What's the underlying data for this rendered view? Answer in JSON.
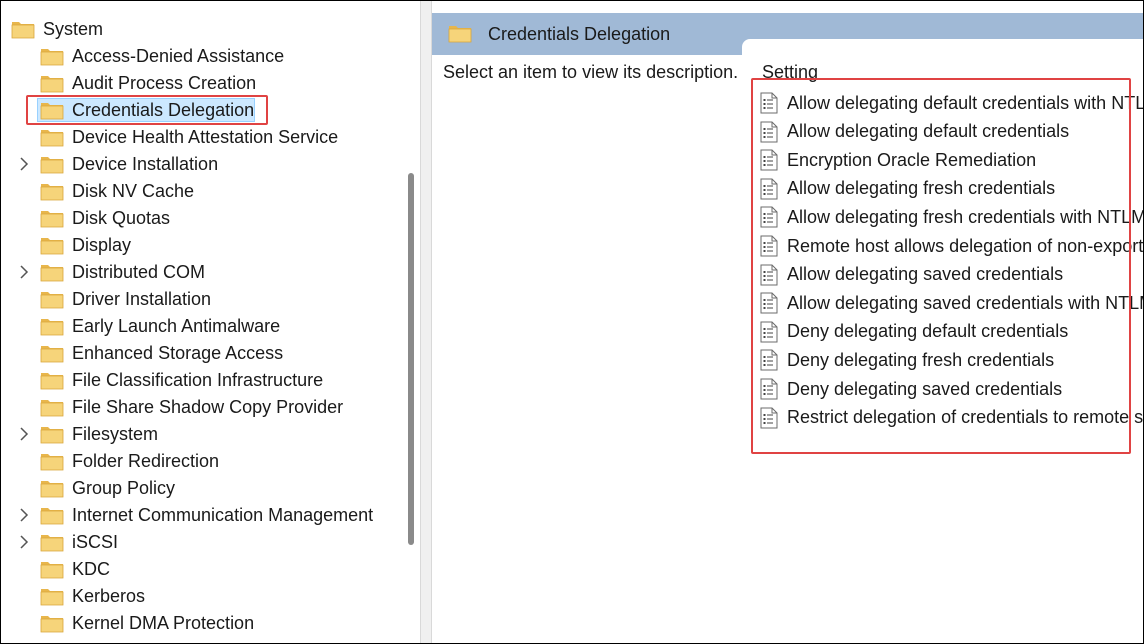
{
  "tree": {
    "root_label": "System",
    "items": [
      {
        "label": "Access-Denied Assistance",
        "expandable": false
      },
      {
        "label": "Audit Process Creation",
        "expandable": false
      },
      {
        "label": "Credentials Delegation",
        "expandable": false,
        "selected": true
      },
      {
        "label": "Device Health Attestation Service",
        "expandable": false
      },
      {
        "label": "Device Installation",
        "expandable": true
      },
      {
        "label": "Disk NV Cache",
        "expandable": false
      },
      {
        "label": "Disk Quotas",
        "expandable": false
      },
      {
        "label": "Display",
        "expandable": false
      },
      {
        "label": "Distributed COM",
        "expandable": true
      },
      {
        "label": "Driver Installation",
        "expandable": false
      },
      {
        "label": "Early Launch Antimalware",
        "expandable": false
      },
      {
        "label": "Enhanced Storage Access",
        "expandable": false
      },
      {
        "label": "File Classification Infrastructure",
        "expandable": false
      },
      {
        "label": "File Share Shadow Copy Provider",
        "expandable": false
      },
      {
        "label": "Filesystem",
        "expandable": true
      },
      {
        "label": "Folder Redirection",
        "expandable": false
      },
      {
        "label": "Group Policy",
        "expandable": false
      },
      {
        "label": "Internet Communication Management",
        "expandable": true
      },
      {
        "label": "iSCSI",
        "expandable": true
      },
      {
        "label": "KDC",
        "expandable": false
      },
      {
        "label": "Kerberos",
        "expandable": false
      },
      {
        "label": "Kernel DMA Protection",
        "expandable": false
      }
    ]
  },
  "details": {
    "header_title": "Credentials Delegation",
    "description_prompt": "Select an item to view its description.",
    "column_header": "Setting",
    "settings": [
      "Allow delegating default credentials with NTLM-only server authentication",
      "Allow delegating default credentials",
      "Encryption Oracle Remediation",
      "Allow delegating fresh credentials",
      "Allow delegating fresh credentials with NTLM-only server authentication",
      "Remote host allows delegation of non-exportable credentials",
      "Allow delegating saved credentials",
      "Allow delegating saved credentials with NTLM-only server authentication",
      "Deny delegating default credentials",
      "Deny delegating fresh credentials",
      "Deny delegating saved credentials",
      "Restrict delegation of credentials to remote servers"
    ]
  },
  "colors": {
    "header_bar": "#a0b9d6",
    "selection_bg": "#cce8ff",
    "highlight_box": "#e04343",
    "folder_fill": "#f6d47a"
  },
  "icons": {
    "folder": "folder-icon",
    "chevron": "chevron-right-icon",
    "setting": "policy-setting-icon"
  }
}
